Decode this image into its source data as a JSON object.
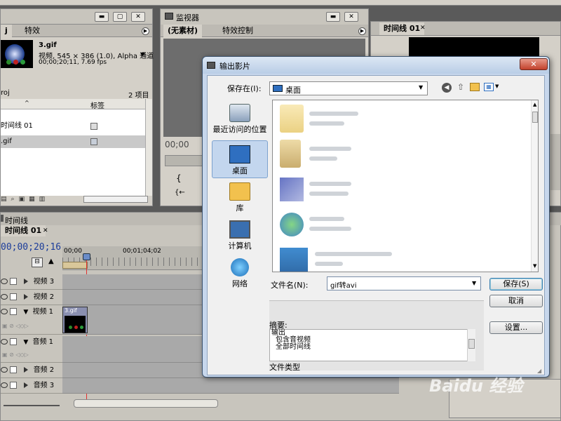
{
  "project": {
    "tabs": [
      "j",
      "特效"
    ],
    "clip_name": "3.gif",
    "clip_info": "视频, 545 × 386 (1.0), Alpha 通道",
    "clip_duration": "00;00;20;11, 7.69 fps",
    "proj_label": "roj",
    "item_count": "2 项目",
    "col_label": "标签",
    "items": [
      "时间线 01",
      ".gif"
    ]
  },
  "monitor": {
    "title": "监视器",
    "tabs": [
      "(无素材)",
      "特效控制"
    ],
    "timecode": "00;00"
  },
  "timeline_tab": {
    "title": "时间线 01"
  },
  "timeline": {
    "panel_title": "时间线",
    "tab": "时间线 01",
    "timecode": "00;00;20;16",
    "ruler": [
      "00;00",
      "00;01;04;02"
    ],
    "tracks": [
      "视频 3",
      "视频 2",
      "视频 1",
      "音频 1",
      "音频 2",
      "音频 3"
    ],
    "clip_label": "3.gif"
  },
  "dialog": {
    "title": "输出影片",
    "save_in_label": "保存在(I):",
    "save_in_value": "桌面",
    "places": [
      "最近访问的位置",
      "桌面",
      "库",
      "计算机",
      "网络"
    ],
    "filename_label": "文件名(N):",
    "filename_value": "gif转avi",
    "save_btn": "保存(S)",
    "cancel_btn": "取消",
    "settings_btn": "设置...",
    "summary_label": "摘要:",
    "summary_lines": [
      "输出",
      "包含音视频",
      "全部时间线"
    ],
    "filetype_label": "文件类型"
  },
  "watermark": "Baidu 经验",
  "colors": {
    "accent": "#1a4fa0",
    "timecode": "#1b3c9a",
    "playhead": "#e23030"
  }
}
